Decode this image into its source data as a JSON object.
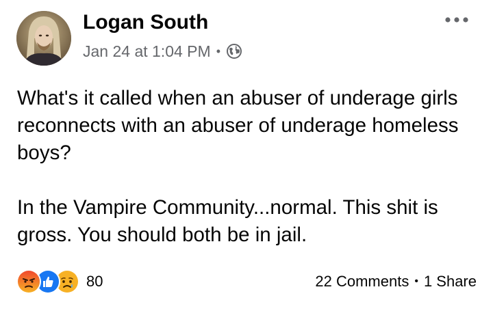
{
  "post": {
    "author": "Logan South",
    "timestamp": "Jan 24 at 1:04 PM",
    "separator": "•",
    "audience_icon": "globe-icon",
    "more_icon": "more-options-icon",
    "paragraphs": [
      "What's it called when an abuser of underage girls reconnects with an abuser of underage homeless boys?",
      "In the Vampire Community...normal. This shit is gross. You should both be in jail."
    ]
  },
  "footer": {
    "reactions": [
      "angry-reaction-icon",
      "like-reaction-icon",
      "sad-reaction-icon"
    ],
    "reaction_count": "80",
    "comments": "22 Comments",
    "separator": "•",
    "shares": "1 Share"
  },
  "colors": {
    "text": "#050505",
    "secondary_text": "#65676b",
    "like_blue": "#1877f2",
    "angry_red": "#e9710f",
    "sad_yellow": "#f7b125"
  }
}
